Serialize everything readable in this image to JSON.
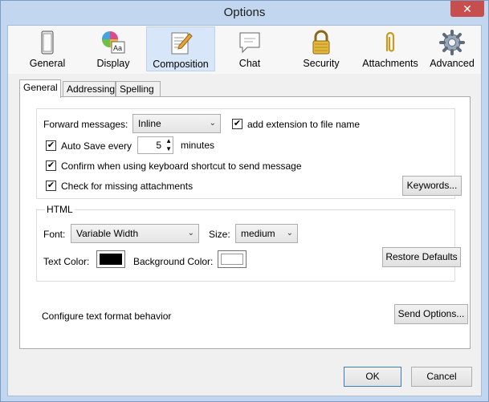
{
  "window": {
    "title": "Options",
    "close_glyph": "✕"
  },
  "toolbar": {
    "items": [
      {
        "label": "General",
        "icon": "general-icon"
      },
      {
        "label": "Display",
        "icon": "display-icon"
      },
      {
        "label": "Composition",
        "icon": "composition-icon",
        "selected": true
      },
      {
        "label": "Chat",
        "icon": "chat-icon"
      },
      {
        "label": "Security",
        "icon": "security-lock-icon"
      },
      {
        "label": "Attachments",
        "icon": "paperclip-icon"
      },
      {
        "label": "Advanced",
        "icon": "gear-icon"
      }
    ]
  },
  "tabs": [
    {
      "label": "General",
      "active": true
    },
    {
      "label": "Addressing",
      "active": false
    },
    {
      "label": "Spelling",
      "active": false
    }
  ],
  "forwarding": {
    "forward_label": "Forward messages:",
    "forward_value": "Inline",
    "add_extension_label": "add extension to file name",
    "add_extension_checked": true,
    "autosave_label": "Auto Save every",
    "autosave_checked": true,
    "autosave_value": "5",
    "autosave_unit": "minutes",
    "confirm_label": "Confirm when using keyboard shortcut to send message",
    "confirm_checked": true,
    "missing_label": "Check for missing attachments",
    "missing_checked": true,
    "keywords_button": "Keywords..."
  },
  "html": {
    "legend": "HTML",
    "font_label": "Font:",
    "font_value": "Variable Width",
    "size_label": "Size:",
    "size_value": "medium",
    "text_color_label": "Text Color:",
    "text_color": "#000000",
    "background_color_label": "Background Color:",
    "background_color": "#ffffff",
    "restore_button": "Restore Defaults"
  },
  "format": {
    "label": "Configure text format behavior",
    "send_options_button": "Send Options..."
  },
  "footer": {
    "ok": "OK",
    "cancel": "Cancel"
  },
  "colors": {
    "accent": "#3c7fb1",
    "titlebar": "#c3d6f0",
    "close": "#c84d4d"
  }
}
